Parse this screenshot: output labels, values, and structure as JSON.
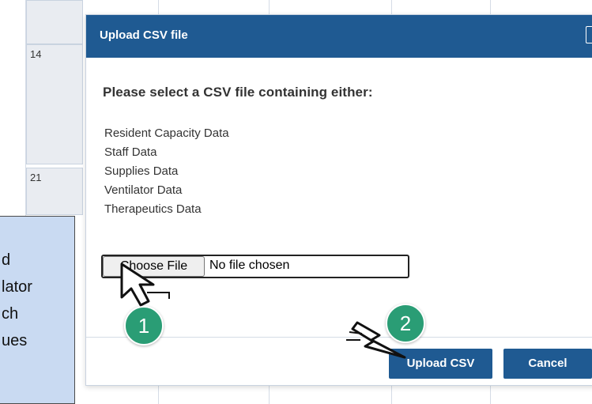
{
  "calendar": {
    "day_numbers": [
      "14",
      "21"
    ]
  },
  "dialog": {
    "title": "Upload CSV file",
    "prompt": "Please select a CSV file containing either:",
    "data_types": [
      "Resident Capacity Data",
      "Staff Data",
      "Supplies Data",
      "Ventilator Data",
      "Therapeutics Data"
    ],
    "file_input": {
      "button_label": "Choose File",
      "status": "No file chosen"
    },
    "buttons": {
      "upload": "Upload CSV",
      "cancel": "Cancel"
    }
  },
  "callout": {
    "lines": [
      "d",
      "lator",
      "ch",
      "ues"
    ]
  },
  "steps": {
    "one": "1",
    "two": "2"
  },
  "colors": {
    "header": "#1f5a92",
    "button": "#1f5a92",
    "badge": "#2a9d75",
    "callout_bg": "#c9daf2"
  },
  "icons": {
    "cursor": "pointer-arrow-icon"
  }
}
